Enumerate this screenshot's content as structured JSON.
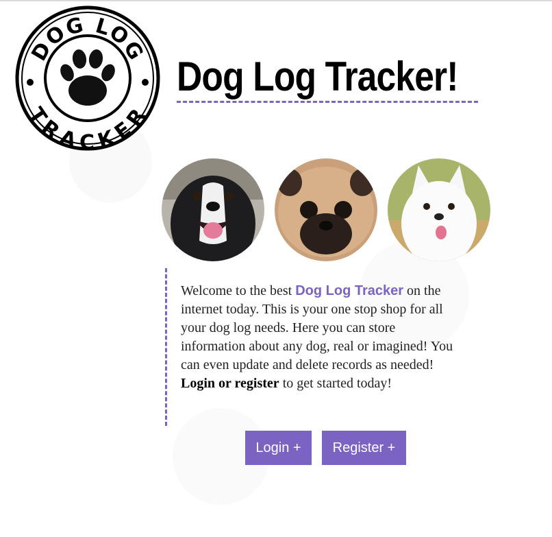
{
  "header": {
    "logo": {
      "text_top": "DOG LOG",
      "text_bottom": "TRACKER"
    },
    "title": "Dog Log Tracker!"
  },
  "photos": [
    {
      "name": "border-collie-photo"
    },
    {
      "name": "pug-photo"
    },
    {
      "name": "white-spitz-photo"
    }
  ],
  "intro": {
    "prefix": "Welcome to the best ",
    "brand": "Dog Log Tracker",
    "middle": " on the internet today. This is your one stop shop for all your dog log needs. Here you can store information about any dog, real or imagined! You can even update and delete records as needed! ",
    "cta_bold": "Login or register",
    "suffix": " to get started today!"
  },
  "buttons": {
    "login": "Login +",
    "register": "Register +"
  },
  "colors": {
    "accent": "#7a63c2",
    "text": "#222222"
  }
}
